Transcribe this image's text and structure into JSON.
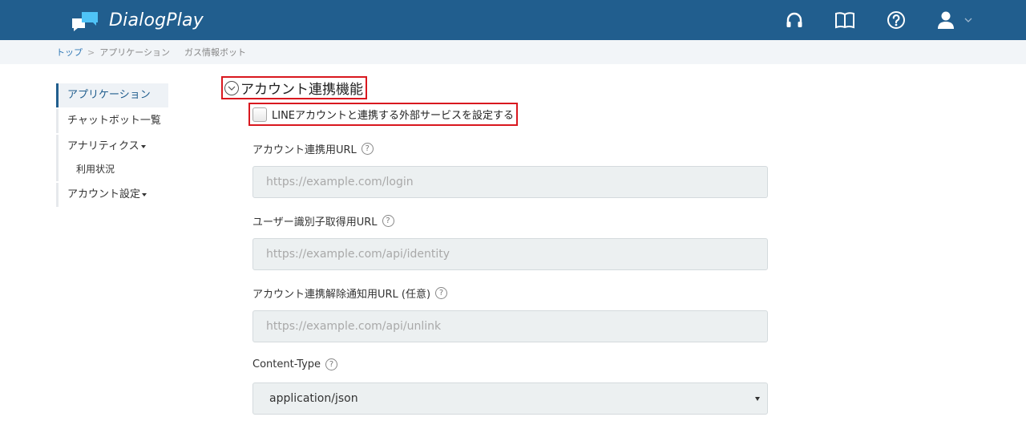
{
  "app": {
    "name": "DialogPlay"
  },
  "header": {
    "icons": [
      "headset-icon",
      "book-icon",
      "help-icon",
      "user-icon"
    ]
  },
  "breadcrumb": {
    "items": [
      "トップ",
      "アプリケーション"
    ],
    "separator": ">",
    "current": "ガス情報ボット"
  },
  "sidebar": {
    "items": [
      {
        "label": "アプリケーション",
        "active": true
      },
      {
        "label": "チャットボット一覧"
      },
      {
        "label": "アナリティクス",
        "has_caret": true
      },
      {
        "label": "利用状況",
        "sub": true
      },
      {
        "label": "アカウント設定",
        "has_caret": true
      }
    ]
  },
  "section": {
    "title": "アカウント連携機能",
    "checkbox_label": "LINEアカウントと連携する外部サービスを設定する",
    "checkbox_checked": false
  },
  "fields": [
    {
      "label": "アカウント連携用URL",
      "placeholder": "https://example.com/login"
    },
    {
      "label": "ユーザー識別子取得用URL",
      "placeholder": "https://example.com/api/identity"
    },
    {
      "label": "アカウント連携解除通知用URL (任意)",
      "placeholder": "https://example.com/api/unlink"
    }
  ],
  "content_type": {
    "label": "Content-Type",
    "selected": "application/json"
  },
  "colors": {
    "header_bg": "#215e8e",
    "highlight_border": "#d9181f",
    "logo_accent": "#4fc3f7"
  }
}
